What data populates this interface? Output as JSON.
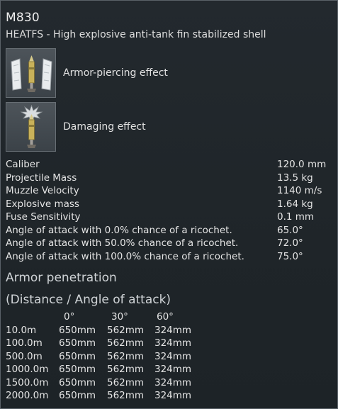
{
  "shell": {
    "name": "M830",
    "description": "HEATFS - High explosive anti-tank fin stabilized shell"
  },
  "effects": [
    {
      "label": "Armor-piercing effect",
      "icon": "armor-piercing-shell-icon"
    },
    {
      "label": "Damaging effect",
      "icon": "damaging-shell-icon"
    }
  ],
  "stats": [
    {
      "label": "Caliber",
      "value": "120.0 mm"
    },
    {
      "label": "Projectile Mass",
      "value": "13.5 kg"
    },
    {
      "label": "Muzzle Velocity",
      "value": "1140 m/s"
    },
    {
      "label": "Explosive mass",
      "value": "1.64 kg"
    },
    {
      "label": "Fuse Sensitivity",
      "value": "0.1 mm"
    },
    {
      "label": "Angle of attack with 0.0% chance of a ricochet.",
      "value": "65.0°"
    },
    {
      "label": "Angle of attack with 50.0% chance of a ricochet.",
      "value": "72.0°"
    },
    {
      "label": "Angle of attack with 100.0% chance of a ricochet.",
      "value": "75.0°"
    }
  ],
  "penetration": {
    "title": "Armor penetration",
    "subtitle": "(Distance / Angle of attack)",
    "angles": [
      "0°",
      "30°",
      "60°"
    ],
    "rows": [
      {
        "distance": "10.0m",
        "values": [
          "650mm",
          "562mm",
          "324mm"
        ]
      },
      {
        "distance": "100.0m",
        "values": [
          "650mm",
          "562mm",
          "324mm"
        ]
      },
      {
        "distance": "500.0m",
        "values": [
          "650mm",
          "562mm",
          "324mm"
        ]
      },
      {
        "distance": "1000.0m",
        "values": [
          "650mm",
          "562mm",
          "324mm"
        ]
      },
      {
        "distance": "1500.0m",
        "values": [
          "650mm",
          "562mm",
          "324mm"
        ]
      },
      {
        "distance": "2000.0m",
        "values": [
          "650mm",
          "562mm",
          "324mm"
        ]
      }
    ]
  },
  "colors": {
    "background": "#1f2529",
    "border": "#5a6168",
    "text": "#e4e4e4",
    "section_heading": "#cfd3d6",
    "shell_body": "#c9b25a"
  }
}
